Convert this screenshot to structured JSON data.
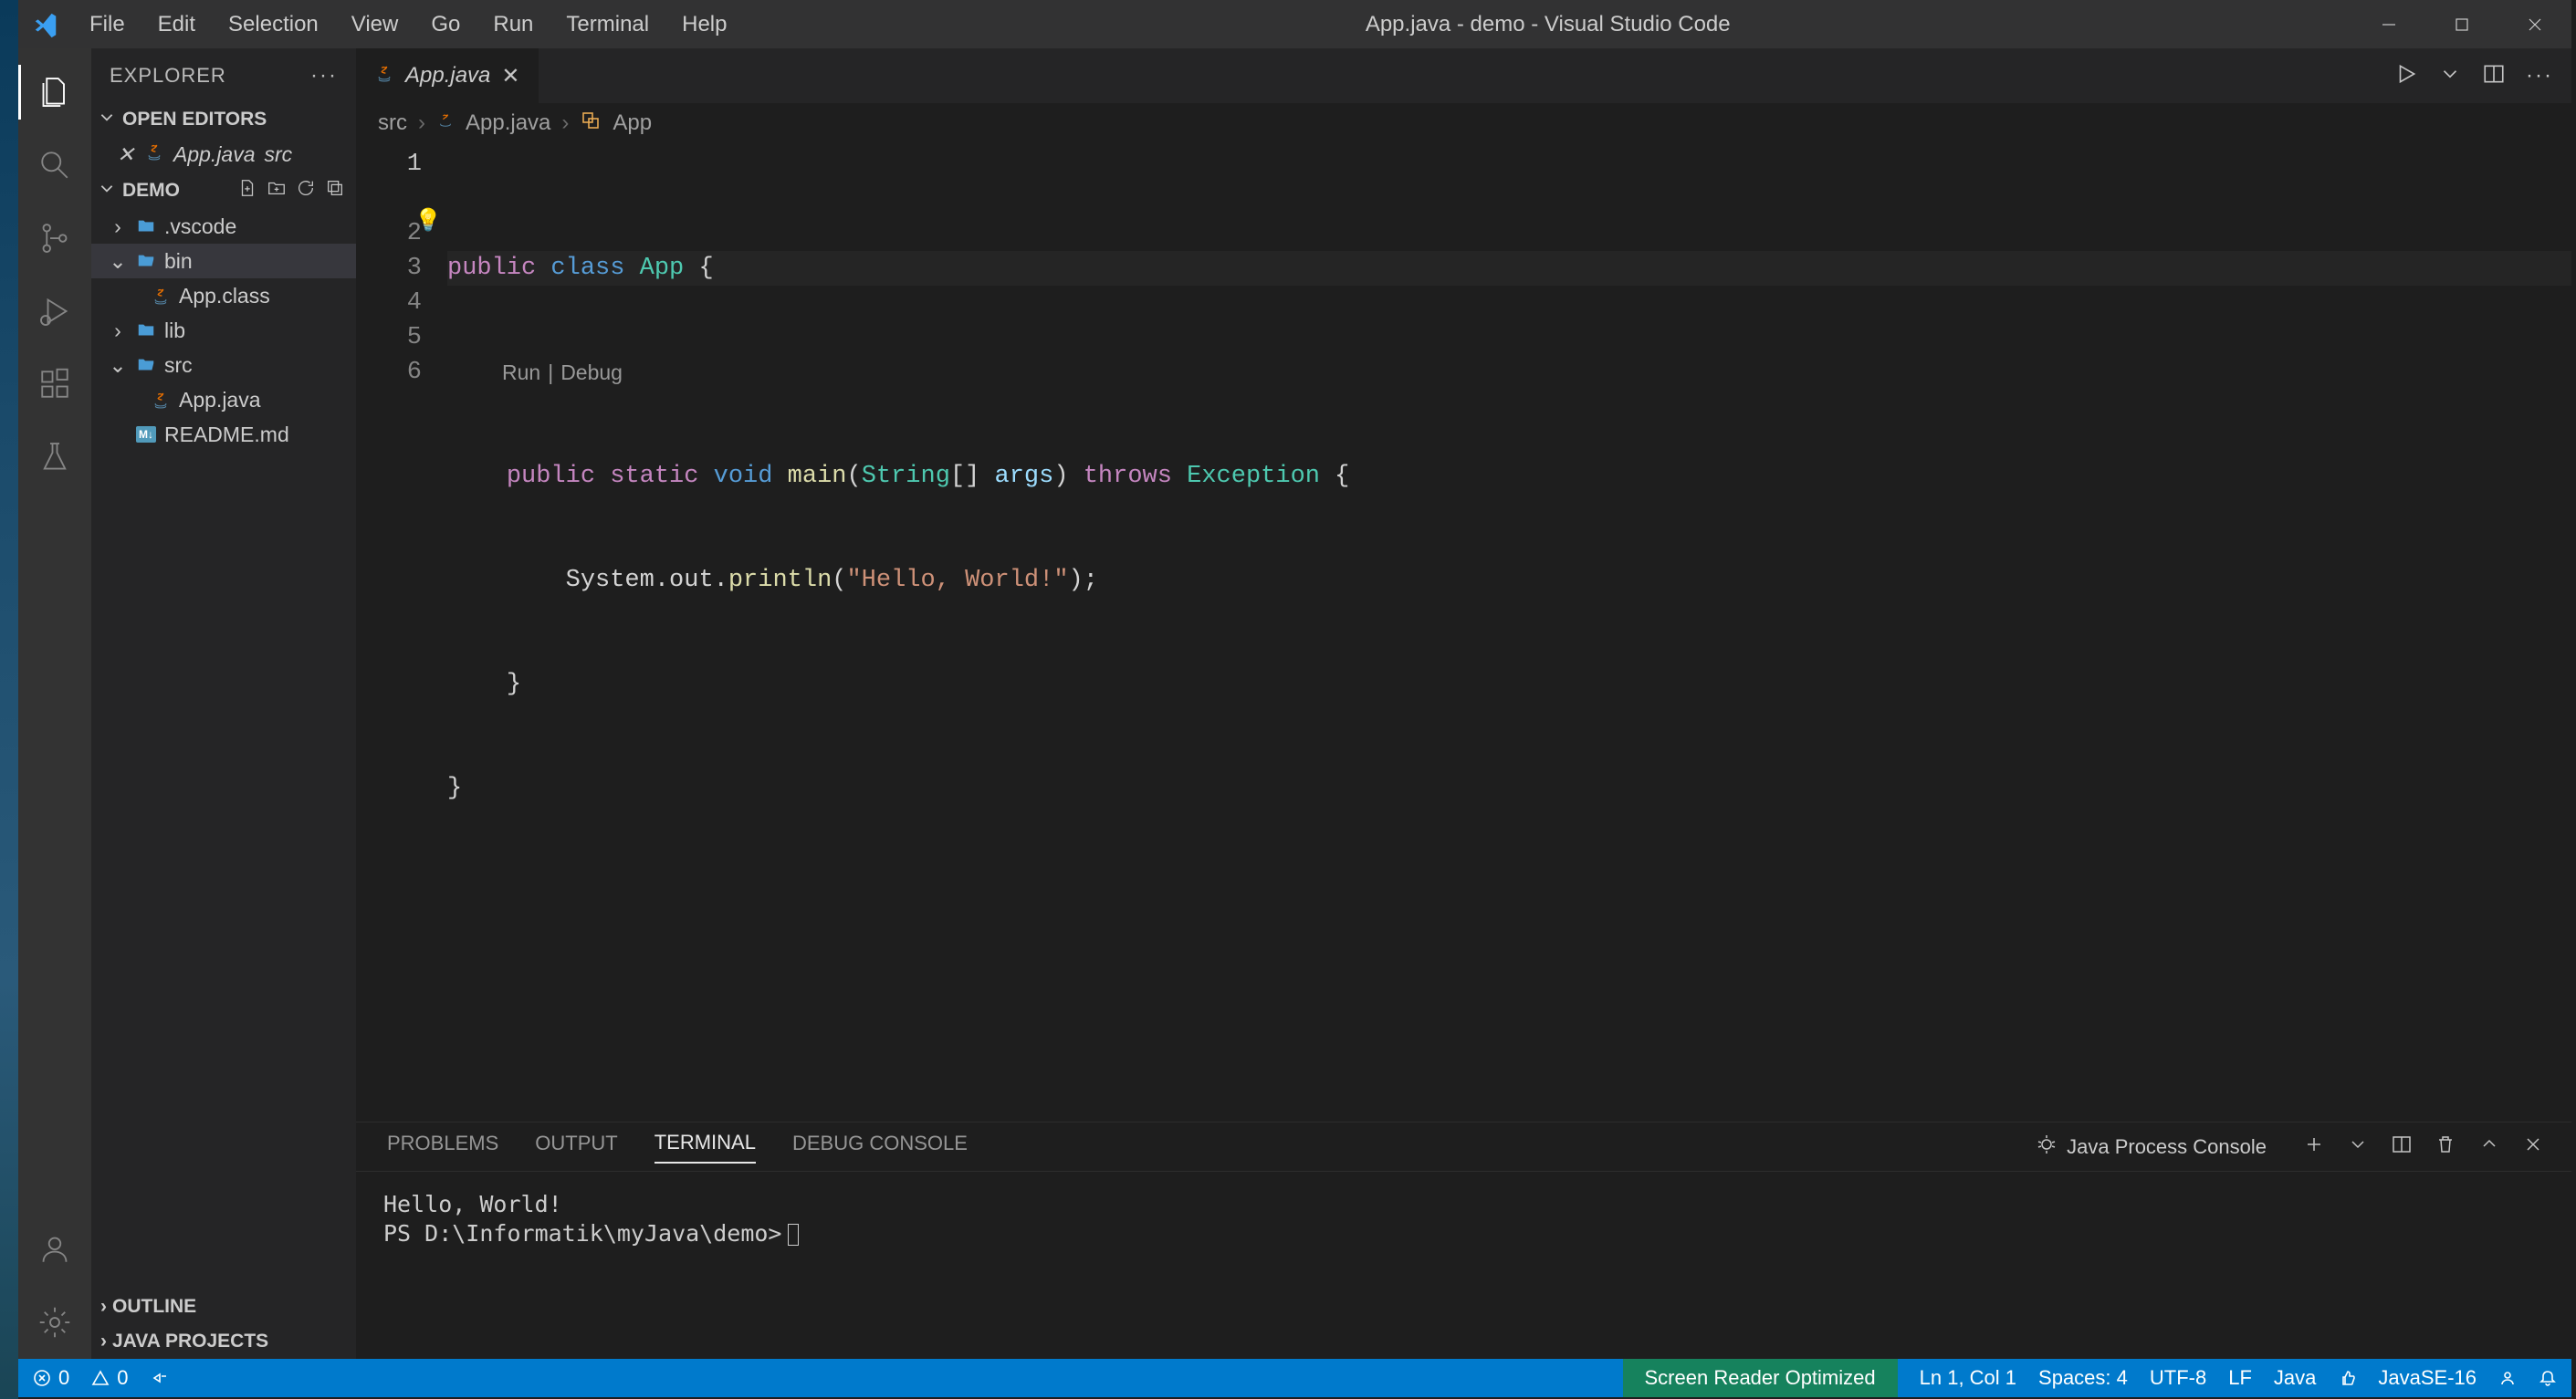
{
  "titlebar": {
    "title": "App.java - demo - Visual Studio Code"
  },
  "menubar": [
    "File",
    "Edit",
    "Selection",
    "View",
    "Go",
    "Run",
    "Terminal",
    "Help"
  ],
  "sidebar": {
    "title": "EXPLORER",
    "sections": {
      "openEditors": {
        "label": "OPEN EDITORS",
        "items": [
          {
            "name": "App.java",
            "detail": "src"
          }
        ]
      },
      "workspace": {
        "label": "DEMO",
        "tree": [
          {
            "type": "folder",
            "name": ".vscode",
            "expanded": false,
            "depth": 0
          },
          {
            "type": "folder",
            "name": "bin",
            "expanded": true,
            "depth": 0,
            "selected": true
          },
          {
            "type": "file",
            "name": "App.class",
            "icon": "java",
            "depth": 1
          },
          {
            "type": "folder",
            "name": "lib",
            "expanded": false,
            "depth": 0
          },
          {
            "type": "folder",
            "name": "src",
            "expanded": true,
            "depth": 0
          },
          {
            "type": "file",
            "name": "App.java",
            "icon": "java",
            "depth": 1
          },
          {
            "type": "file",
            "name": "README.md",
            "icon": "md",
            "depth": 0
          }
        ]
      },
      "outline": {
        "label": "OUTLINE"
      },
      "javaProjects": {
        "label": "JAVA PROJECTS"
      }
    }
  },
  "editor": {
    "tab": {
      "name": "App.java"
    },
    "breadcrumb": [
      "src",
      "App.java",
      "App"
    ],
    "codelens": {
      "run": "Run",
      "debug": "Debug"
    },
    "lines": {
      "l1_public": "public",
      "l1_class": "class",
      "l1_name": "App",
      "l1_brace": " {",
      "l2_public": "public",
      "l2_static": "static",
      "l2_void": "void",
      "l2_main": "main",
      "l2_paren": "(",
      "l2_string": "String",
      "l2_brackets": "[] ",
      "l2_args": "args",
      "l2_paren2": ") ",
      "l2_throws": "throws",
      "l2_exc": "Exception",
      "l2_brace": " {",
      "l3_sys": "System",
      "l3_dot1": ".",
      "l3_out": "out",
      "l3_dot2": ".",
      "l3_println": "println",
      "l3_paren": "(",
      "l3_str": "\"Hello, World!\"",
      "l3_end": ");",
      "l4": "}",
      "l5": "}"
    }
  },
  "panel": {
    "tabs": [
      "PROBLEMS",
      "OUTPUT",
      "TERMINAL",
      "DEBUG CONSOLE"
    ],
    "activeTab": "TERMINAL",
    "info": "Java Process Console",
    "output": {
      "line1": "Hello, World!",
      "line2": "PS D:\\Informatik\\myJava\\demo>"
    }
  },
  "statusbar": {
    "errors": "0",
    "warnings": "0",
    "screenReader": "Screen Reader Optimized",
    "lnCol": "Ln 1, Col 1",
    "spaces": "Spaces: 4",
    "encoding": "UTF-8",
    "eol": "LF",
    "language": "Java",
    "jdk": "JavaSE-16"
  }
}
